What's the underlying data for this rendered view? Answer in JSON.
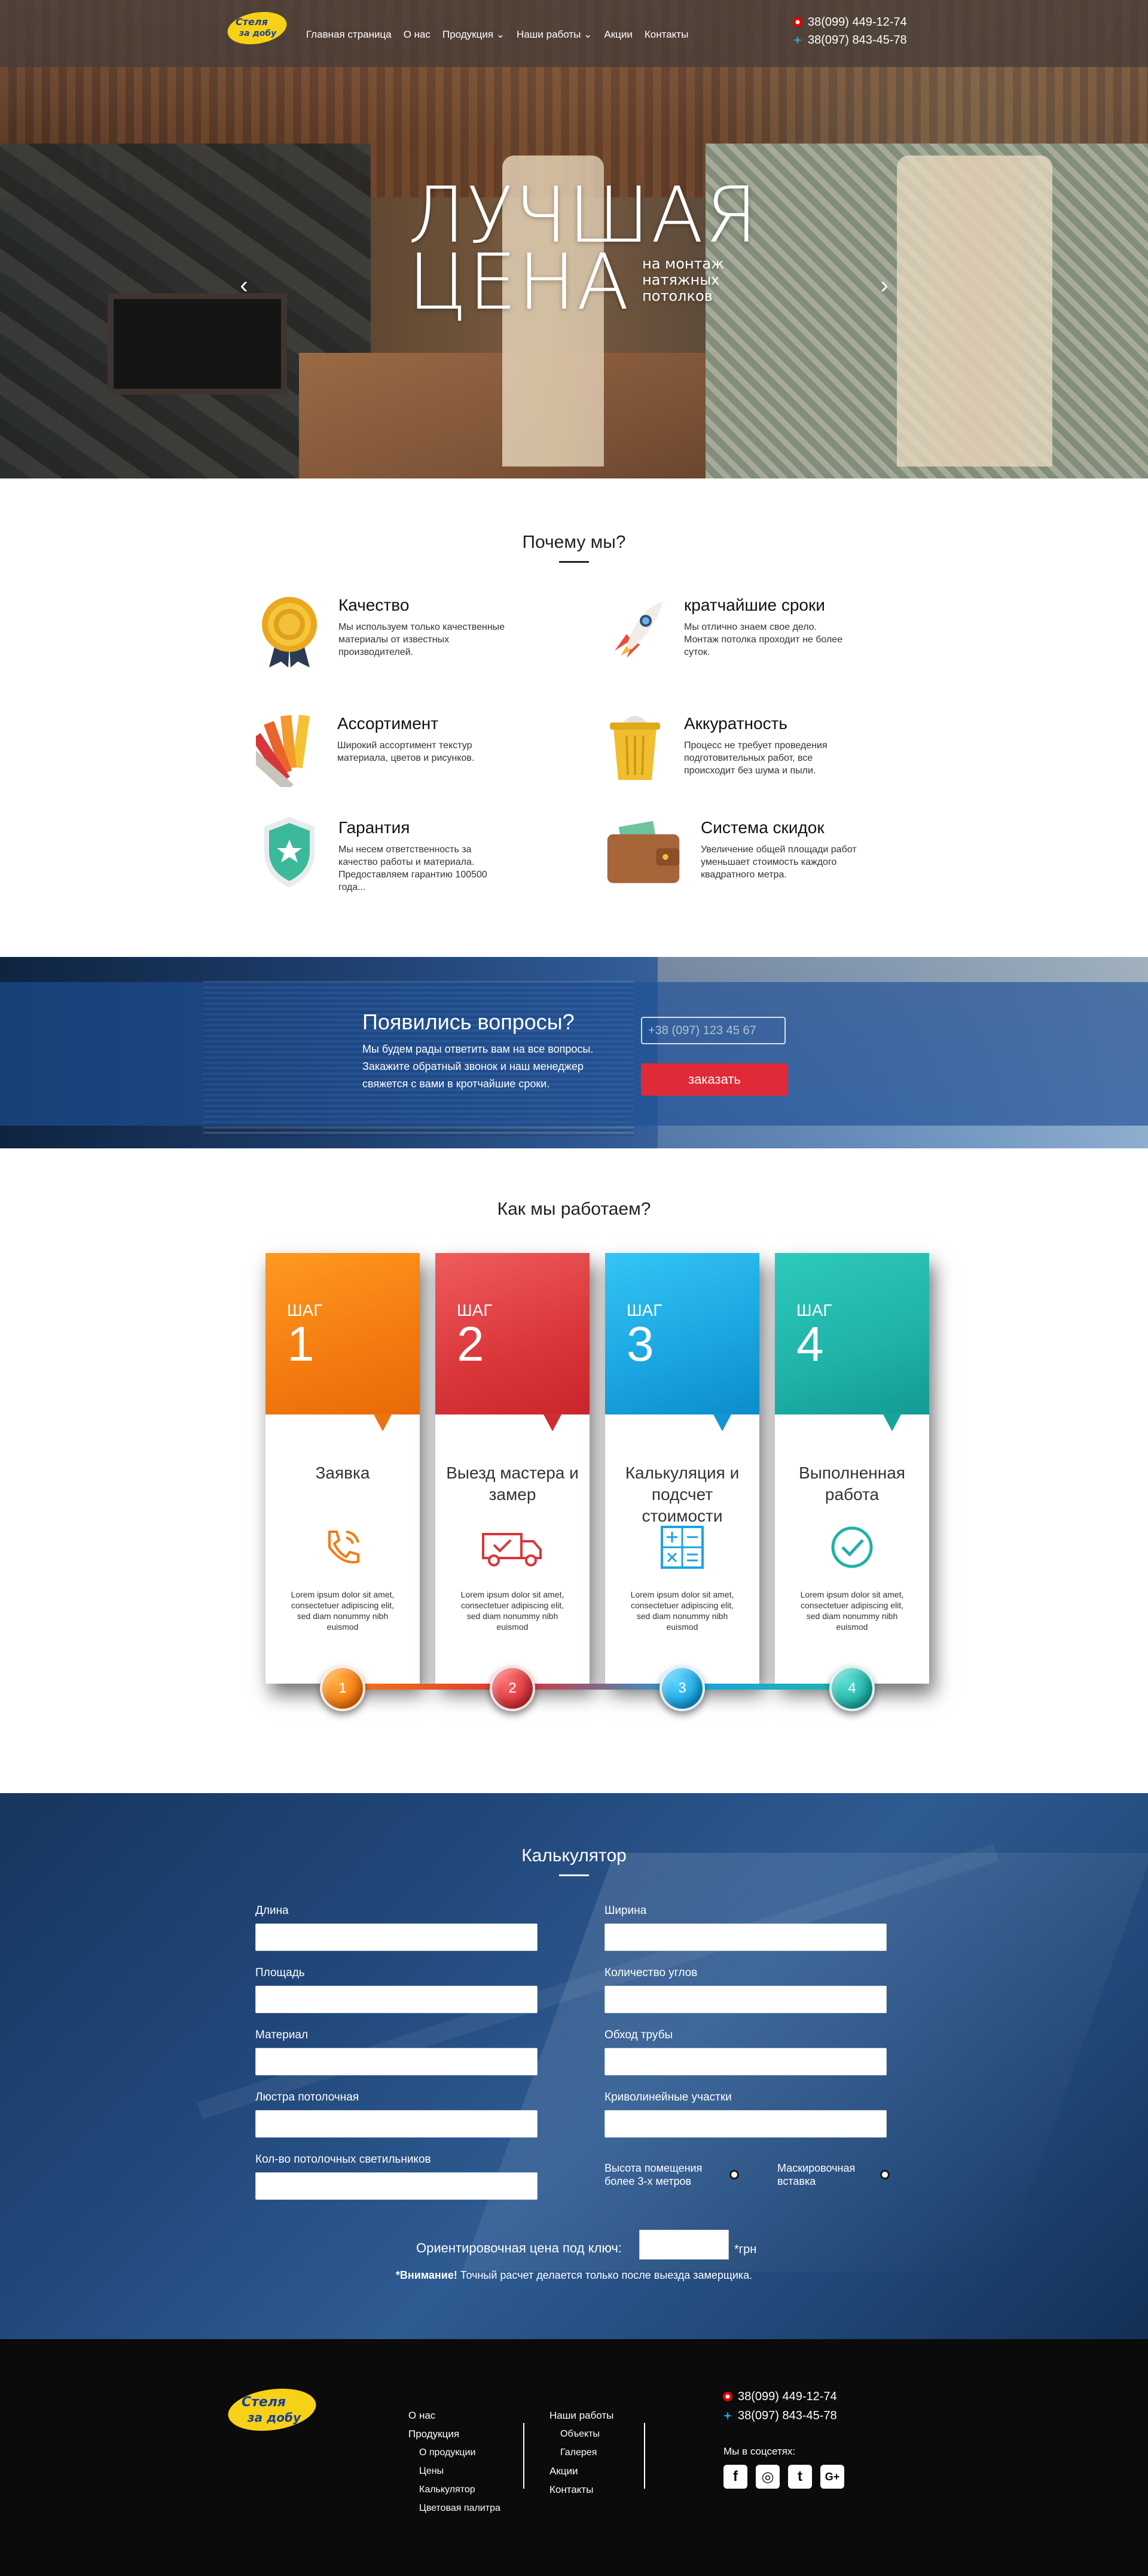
{
  "header": {
    "logo_text_1": "Стеля",
    "logo_text_2": "за добу",
    "nav": [
      "Главная страница",
      "О нас",
      "Продукция",
      "Наши работы",
      "Акции",
      "Контакты"
    ],
    "phones": [
      "38(099) 449-12-74",
      "38(097) 843-45-78"
    ]
  },
  "hero": {
    "title_1": "ЛУЧШАЯ",
    "title_2": "ЦЕНА",
    "subtitle": "на монтаж натяжных потолков",
    "arrow_left": "‹",
    "arrow_right": "›"
  },
  "why": {
    "title": "Почему мы?",
    "features": [
      {
        "title": "Качество",
        "text": "Мы используем только качественные материалы от известных производителей.",
        "icon": "medal-icon"
      },
      {
        "title": "кратчайшие сроки",
        "text": "Мы отлично знаем свое дело. Монтаж потолка проходит не более суток.",
        "icon": "rocket-icon"
      },
      {
        "title": "Ассортимент",
        "text": "Широкий ассортимент текстур материала, цветов и рисунков.",
        "icon": "color-palette-icon"
      },
      {
        "title": "Аккуратность",
        "text": "Процесс не требует проведения подготовительных работ, все происходит без шума и пыли.",
        "icon": "trash-bin-icon"
      },
      {
        "title": "Гарантия",
        "text": "Мы несем ответственность за качество работы и материала. Предоставляем гарантию 100500 года...",
        "icon": "shield-star-icon"
      },
      {
        "title": "Система скидок",
        "text": "Увеличение общей площади работ уменьшает стоимость каждого квадратного метра.",
        "icon": "wallet-icon"
      }
    ]
  },
  "questions": {
    "heading": "Появились вопросы?",
    "text": "Мы будем рады ответить вам на все вопросы. Закажите обратный звонок и наш менеджер свяжется с вами в кротчайшие сроки.",
    "phone_placeholder": "+38 (097) 123 45 67",
    "button": "заказать"
  },
  "how": {
    "title": "Как мы работаем?",
    "step_label": "ШАГ",
    "steps": [
      {
        "num": "1",
        "name": "Заявка",
        "desc": "Lorem ipsum dolor sit amet, consectetuer adipiscing elit, sed diam nonummy nibh euismod",
        "color": "#f47a10",
        "icon": "phone-call-icon"
      },
      {
        "num": "2",
        "name": "Выезд мастера и замер",
        "desc": "Lorem ipsum dolor sit amet, consectetuer adipiscing elit, sed diam nonummy nibh euismod",
        "color": "#d9363a",
        "icon": "truck-icon"
      },
      {
        "num": "3",
        "name": "Калькуляция и подсчет стоимости",
        "desc": "Lorem ipsum dolor sit amet, consectetuer adipiscing elit, sed diam nonummy nibh euismod",
        "color": "#1aa4e0",
        "icon": "calculator-icon"
      },
      {
        "num": "4",
        "name": "Выполненная работа",
        "desc": "Lorem ipsum dolor sit amet, consectetuer adipiscing elit, sed diam nonummy nibh euismod",
        "color": "#1fb2a8",
        "icon": "check-circle-icon"
      }
    ]
  },
  "calc": {
    "title": "Калькулятор",
    "fields_left": [
      "Длина",
      "Площадь",
      "Материал",
      "Люстра потолочная",
      "Кол-во потолочных светильников"
    ],
    "fields_right": [
      "Ширина",
      "Количество углов",
      "Обход трубы",
      "Криволинейные участки"
    ],
    "check_1": "Высота помещения более 3-х метров",
    "check_2": "Маскировочная вставка",
    "price_label": "Ориентировочная цена под ключ:",
    "price_unit": "*грн",
    "note_bold": "*Внимание!",
    "note_text": " Точный расчет делается только после выезда замерщика."
  },
  "footer": {
    "col1": [
      "О нас",
      "Продукция"
    ],
    "col1_sub": [
      "О продукции",
      "Цены",
      "Калькулятор",
      "Цветовая палитра"
    ],
    "col2": [
      "Наши работы"
    ],
    "col2_sub": [
      "Объекты",
      "Галерея"
    ],
    "col2_tail": [
      "Акции",
      "Контакты"
    ],
    "phones": [
      "38(099) 449-12-74",
      "38(097) 843-45-78"
    ],
    "social_label": "Мы в соцсетях:",
    "social": [
      "f",
      "◎",
      "t",
      "G+"
    ]
  },
  "colors": {
    "accent_red": "#e02a37",
    "step1": "#f47a10",
    "step2": "#d9363a",
    "step3": "#1aa4e0",
    "step4": "#1fb2a8"
  }
}
